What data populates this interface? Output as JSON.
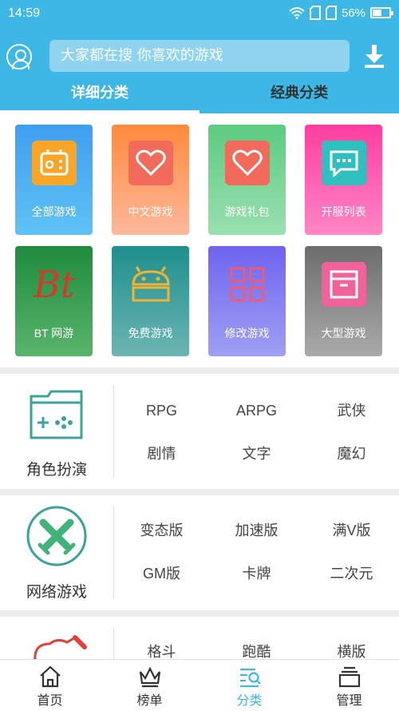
{
  "status_bar": {
    "time": "14:59",
    "battery": "56%",
    "battery_level": 0.56
  },
  "header": {
    "search_placeholder": "大家都在搜  你喜欢的游戏",
    "tabs": [
      {
        "label": "详细分类",
        "active": true
      },
      {
        "label": "经典分类",
        "active": false
      }
    ]
  },
  "grid": [
    {
      "label": "全部游戏",
      "icon": "gamepad-icon",
      "color": "#3f9ff0"
    },
    {
      "label": "中文游戏",
      "icon": "heart-icon",
      "color": "#ff8a3d"
    },
    {
      "label": "游戏礼包",
      "icon": "heart-icon",
      "color": "#5ccb80"
    },
    {
      "label": "开服列表",
      "icon": "chat-bubble-icon",
      "color": "#ff3d9e"
    },
    {
      "label": "BT 网游",
      "icon": "bt-logo-icon",
      "color": "#1f8b3c",
      "icon_text": "Bt"
    },
    {
      "label": "免费游戏",
      "icon": "android-icon",
      "color": "#1e8f8c"
    },
    {
      "label": "修改游戏",
      "icon": "grid-squares-icon",
      "color": "#6f63ee"
    },
    {
      "label": "大型游戏",
      "icon": "archive-box-icon",
      "color": "#6d6d6d"
    }
  ],
  "sections": [
    {
      "title": "角色扮演",
      "icon": "controller-folder-icon",
      "items": [
        "RPG",
        "ARPG",
        "武侠",
        "剧情",
        "文字",
        "魔幻"
      ]
    },
    {
      "title": "网络游戏",
      "icon": "crossed-swords-icon",
      "items": [
        "变态版",
        "加速版",
        "满V版",
        "GM版",
        "卡牌",
        "二次元"
      ]
    },
    {
      "title": "",
      "icon": "boxing-glove-icon",
      "items": [
        "格斗",
        "跑酷",
        "横版"
      ]
    }
  ],
  "bottom_nav": [
    {
      "label": "首页",
      "icon": "home-icon",
      "active": false
    },
    {
      "label": "榜单",
      "icon": "crown-icon",
      "active": false
    },
    {
      "label": "分类",
      "icon": "category-search-icon",
      "active": true
    },
    {
      "label": "管理",
      "icon": "stack-icon",
      "active": false
    }
  ],
  "colors": {
    "primary": "#3cb7e6",
    "background": "#ececec"
  }
}
